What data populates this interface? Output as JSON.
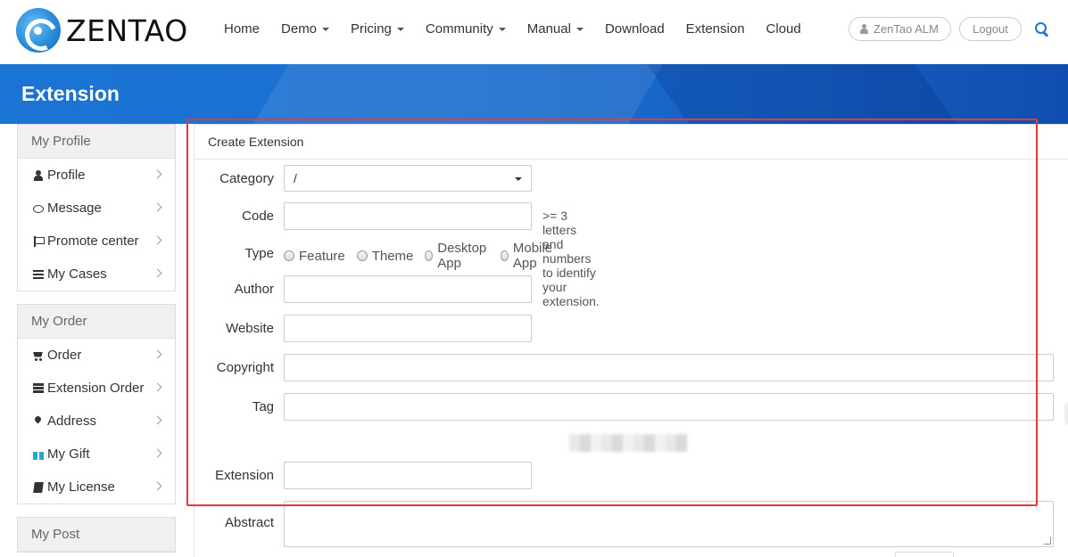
{
  "header": {
    "logo_text": "ZENTAO",
    "nav": [
      {
        "label": "Home",
        "dropdown": false
      },
      {
        "label": "Demo",
        "dropdown": true
      },
      {
        "label": "Pricing",
        "dropdown": true
      },
      {
        "label": "Community",
        "dropdown": true
      },
      {
        "label": "Manual",
        "dropdown": true
      },
      {
        "label": "Download",
        "dropdown": false
      },
      {
        "label": "Extension",
        "dropdown": false
      },
      {
        "label": "Cloud",
        "dropdown": false
      }
    ],
    "user_label": "ZenTao ALM",
    "logout_label": "Logout"
  },
  "banner": {
    "title": "Extension"
  },
  "sidebar": {
    "groups": [
      {
        "title": "My Profile",
        "items": [
          {
            "label": "Profile",
            "icon": "user-icon"
          },
          {
            "label": "Message",
            "icon": "message-icon"
          },
          {
            "label": "Promote center",
            "icon": "flag-icon"
          },
          {
            "label": "My Cases",
            "icon": "list-icon"
          }
        ]
      },
      {
        "title": "My Order",
        "items": [
          {
            "label": "Order",
            "icon": "cart-icon"
          },
          {
            "label": "Extension Order",
            "icon": "table-list-icon"
          },
          {
            "label": "Address",
            "icon": "map-pin-icon"
          },
          {
            "label": "My Gift",
            "icon": "gift-icon"
          },
          {
            "label": "My License",
            "icon": "book-icon"
          }
        ]
      },
      {
        "title": "My Post",
        "items": []
      }
    ]
  },
  "form": {
    "title": "Create Extension",
    "category": {
      "label": "Category",
      "value": "/"
    },
    "code": {
      "label": "Code",
      "value": "",
      "hint": ">= 3 letters and numbers to identify your extension."
    },
    "type": {
      "label": "Type",
      "options": [
        "Feature",
        "Theme",
        "Desktop App",
        "Mobile App"
      ]
    },
    "author": {
      "label": "Author",
      "value": ""
    },
    "website": {
      "label": "Website",
      "value": ""
    },
    "copyright": {
      "label": "Copyright",
      "value": ""
    },
    "tag": {
      "label": "Tag",
      "value": ""
    },
    "extension": {
      "label": "Extension",
      "value": ""
    },
    "abstract": {
      "label": "Abstract",
      "value": ""
    }
  },
  "colors": {
    "accent": "#1d74d6",
    "banner": "#1a6fd0",
    "highlight_border": "#e53935",
    "gift_icon": "#27a9c8"
  }
}
